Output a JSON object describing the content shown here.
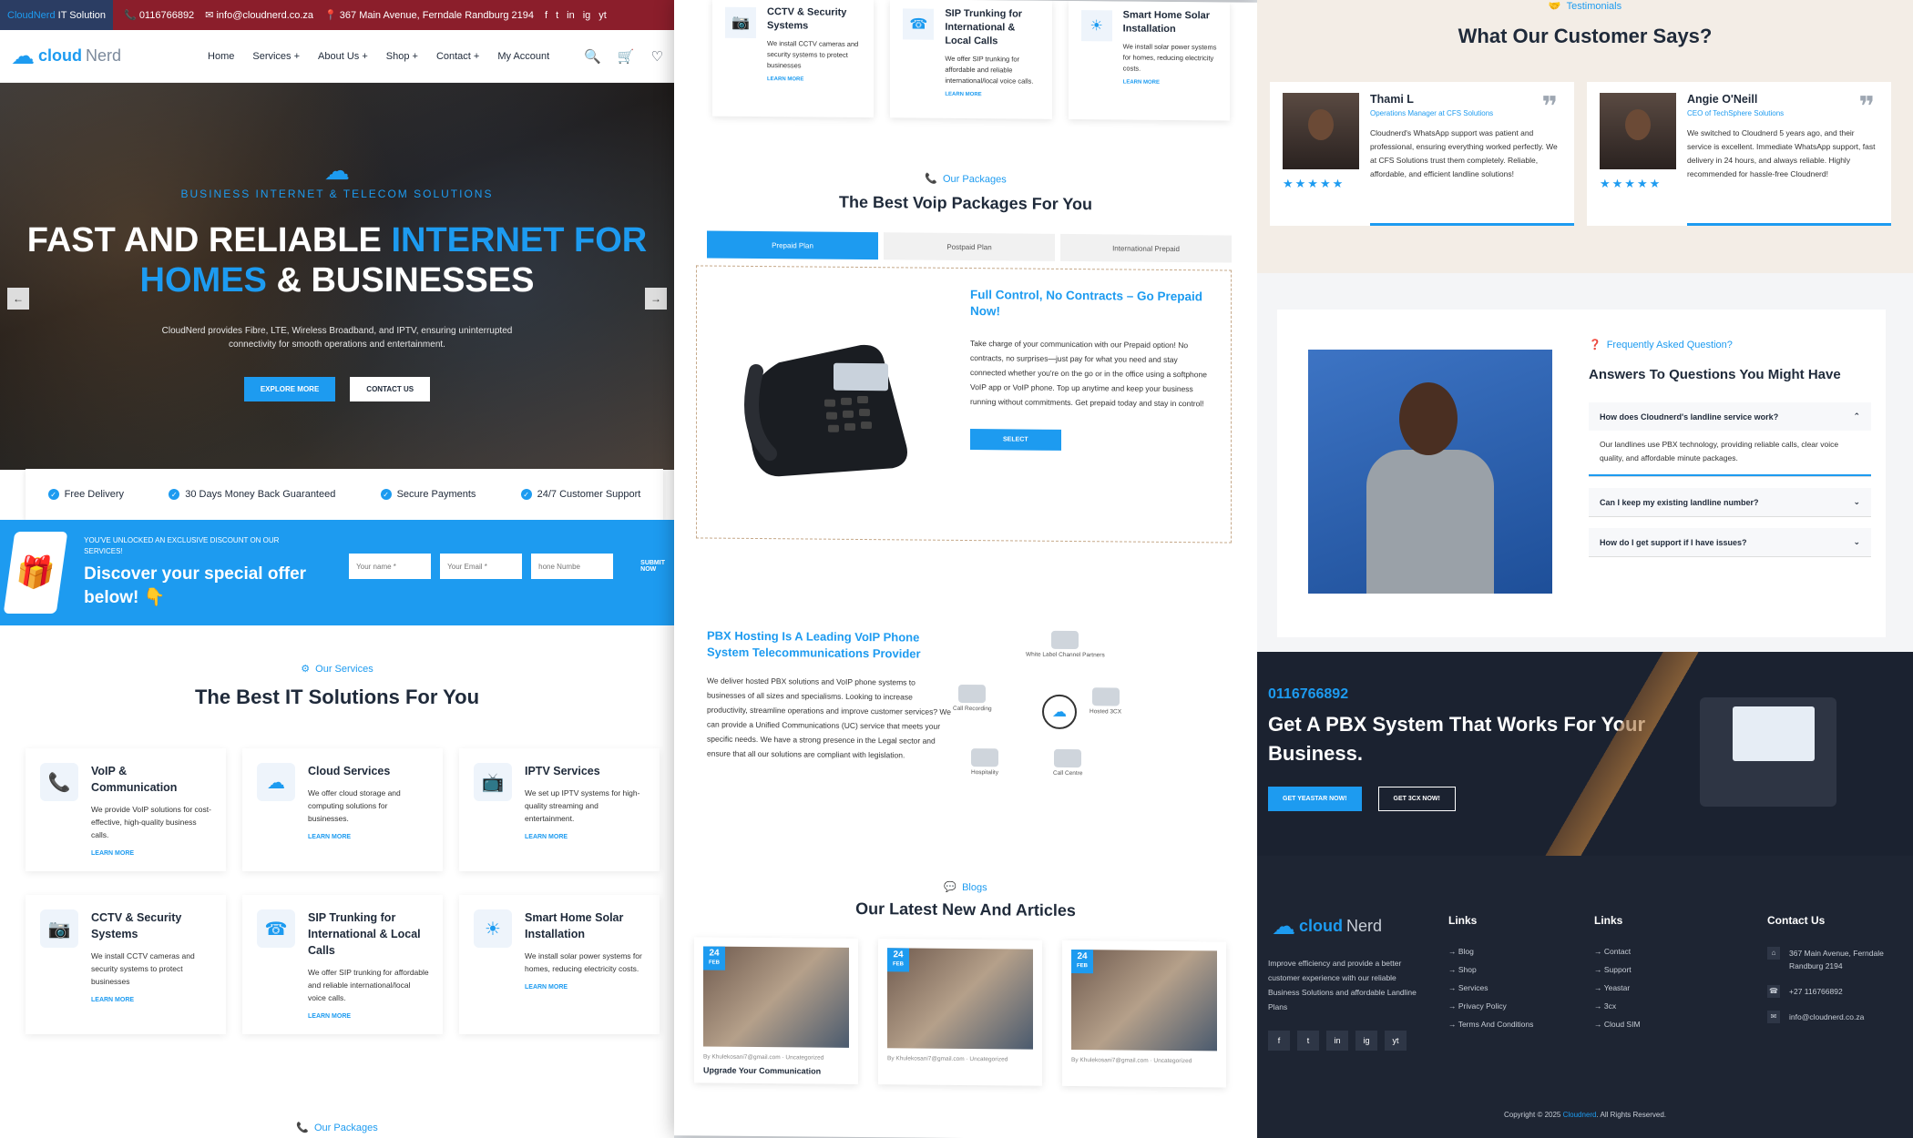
{
  "left": {
    "topbar": {
      "brand_a": "CloudNerd",
      "brand_b": "IT Solution",
      "phone": "0116766892",
      "email": "info@cloudnerd.co.za",
      "address": "367 Main Avenue, Ferndale Randburg 2194",
      "social": [
        "f",
        "t",
        "in",
        "ig",
        "yt"
      ]
    },
    "nav": {
      "logo_a": "cloud",
      "logo_b": "Nerd",
      "links": [
        "Home",
        "Services +",
        "About Us +",
        "Shop +",
        "Contact +",
        "My Account"
      ],
      "icons": [
        "search-icon",
        "cart-icon",
        "heart-icon"
      ]
    },
    "hero": {
      "kicker": "BUSINESS INTERNET & TELECOM SOLUTIONS",
      "title_a": "FAST AND RELIABLE ",
      "title_b": "INTERNET FOR",
      "title_c": "HOMES",
      "title_d": " & BUSINESSES",
      "desc": "CloudNerd provides Fibre, LTE, Wireless Broadband, and IPTV, ensuring uninterrupted connectivity for smooth operations and entertainment.",
      "btn_explore": "EXPLORE MORE",
      "btn_contact": "CONTACT US",
      "prev": "←",
      "next": "→"
    },
    "features": [
      "Free Delivery",
      "30 Days Money Back Guaranteed",
      "Secure Payments",
      "24/7 Customer Support"
    ],
    "discount": {
      "small": "YOU'VE UNLOCKED AN EXCLUSIVE DISCOUNT ON OUR SERVICES!",
      "big": "Discover your special offer below! 👇",
      "name_ph": "Your name *",
      "email_ph": "Your Email *",
      "phone_ph": "hone Numbe",
      "submit": "SUBMIT NOW"
    },
    "services": {
      "kicker": "Our Services",
      "title": "The Best IT Solutions For You",
      "items": [
        {
          "icon": "phone-icon",
          "title": "VoIP & Communication",
          "desc": "We provide VoIP solutions for cost-effective, high-quality business calls.",
          "link": "LEARN MORE"
        },
        {
          "icon": "cloud-icon",
          "title": "Cloud Services",
          "desc": "We offer cloud storage and computing solutions for businesses.",
          "link": "LEARN MORE"
        },
        {
          "icon": "tv-icon",
          "title": "IPTV Services",
          "desc": "We set up IPTV systems for high-quality streaming and entertainment.",
          "link": "LEARN MORE"
        },
        {
          "icon": "camera-icon",
          "title": "CCTV & Security Systems",
          "desc": "We install CCTV cameras and security systems to protect businesses",
          "link": "LEARN MORE"
        },
        {
          "icon": "sip-icon",
          "title": "SIP Trunking for International & Local Calls",
          "desc": "We offer SIP trunking for affordable and reliable international/local voice calls.",
          "link": "LEARN MORE"
        },
        {
          "icon": "solar-icon",
          "title": "Smart Home Solar Installation",
          "desc": "We install solar power systems for homes, reducing electricity costs.",
          "link": "LEARN MORE"
        }
      ]
    },
    "packages_kicker": "Our Packages"
  },
  "mid": {
    "top_cards": [
      {
        "icon": "camera-icon",
        "title": "CCTV & Security Systems",
        "desc": "We install CCTV cameras and security systems to protect businesses",
        "link": "LEARN MORE"
      },
      {
        "icon": "sip-icon",
        "title": "SIP Trunking for International & Local Calls",
        "desc": "We offer SIP trunking for affordable and reliable international/local voice calls.",
        "link": "LEARN MORE"
      },
      {
        "icon": "solar-icon",
        "title": "Smart Home Solar Installation",
        "desc": "We install solar power systems for homes, reducing electricity costs.",
        "link": "LEARN MORE"
      }
    ],
    "packages": {
      "kicker": "Our Packages",
      "title": "The Best Voip Packages For You",
      "tabs": [
        "Prepaid Plan",
        "Postpaid Plan",
        "International Prepaid"
      ],
      "heading": "Full Control, No Contracts – Go Prepaid Now!",
      "desc": "Take charge of your communication with our Prepaid option! No contracts, no surprises—just pay for what you need and stay connected whether you're on the go or in the office using a softphone VoIP app or VoIP phone. Top up anytime and keep your business running without commitments. Get prepaid today and stay in control!",
      "select": "SELECT"
    },
    "pbx": {
      "title": "PBX Hosting Is A Leading VoIP Phone System Telecommunications Provider",
      "desc": "We deliver hosted PBX solutions and VoIP phone systems to businesses of all sizes and specialisms. Looking to increase productivity, streamline operations and improve customer services? We can provide a Unified Communications (UC) service that meets your specific needs. We have a strong presence in the Legal sector and ensure that all our solutions are compliant with legislation.",
      "nodes": [
        "White Label Channel Partners",
        "Call Recording",
        "Hosted 3CX",
        "Hospitality",
        "Call Centre"
      ]
    },
    "blogs": {
      "kicker": "Blogs",
      "title": "Our Latest New And Articles",
      "items": [
        {
          "day": "24",
          "month": "FEB",
          "meta": "By Khulekosani7@gmail.com  ·  Uncategorized",
          "title": "Upgrade Your Communication"
        },
        {
          "day": "24",
          "month": "FEB",
          "meta": "By Khulekosani7@gmail.com  ·  Uncategorized",
          "title": ""
        },
        {
          "day": "24",
          "month": "FEB",
          "meta": "By Khulekosani7@gmail.com  ·  Uncategorized",
          "title": ""
        }
      ]
    }
  },
  "right": {
    "testimonials": {
      "kicker": "Testimonials",
      "title": "What Our Customer Says?",
      "items": [
        {
          "name": "Thami L",
          "role": "Operations Manager at CFS Solutions",
          "text": "Cloudnerd's WhatsApp support was patient and professional, ensuring everything worked perfectly. We at CFS Solutions trust them completely. Reliable, affordable, and efficient landline solutions!",
          "stars": "★★★★★"
        },
        {
          "name": "Angie O'Neill",
          "role": "CEO of TechSphere Solutions",
          "text": "We switched to Cloudnerd 5 years ago, and their service is excellent. Immediate WhatsApp support, fast delivery in 24 hours, and always reliable. Highly recommended for hassle-free Cloudnerd!",
          "stars": "★★★★★"
        }
      ]
    },
    "faq": {
      "kicker": "Frequently Asked Question?",
      "title": "Answers To Questions You Might Have",
      "items": [
        {
          "q": "How does Cloudnerd's landline service work?",
          "a": "Our landlines use PBX technology, providing reliable calls, clear voice quality, and affordable minute packages.",
          "open": true
        },
        {
          "q": "Can I keep my existing landline number?",
          "a": "",
          "open": false
        },
        {
          "q": "How do I get support if I have issues?",
          "a": "",
          "open": false
        }
      ]
    },
    "cta": {
      "phone": "0116766892",
      "title": "Get A PBX System That Works For Your Business.",
      "btn1": "GET YEASTAR NOW!",
      "btn2": "GET 3CX NOW!"
    },
    "footer": {
      "logo_a": "cloud",
      "logo_b": "Nerd",
      "desc": "Improve efficiency and provide a better customer experience with our reliable Business Solutions and affordable Landline Plans",
      "social": [
        "f",
        "t",
        "in",
        "ig",
        "yt"
      ],
      "links1_title": "Links",
      "links1": [
        "→ Blog",
        "→ Shop",
        "→ Services",
        "→ Privacy Policy",
        "→ Terms And Conditions"
      ],
      "links2_title": "Links",
      "links2": [
        "→ Contact",
        "→ Support",
        "→ Yeastar",
        "→ 3cx",
        "→ Cloud SIM"
      ],
      "contact_title": "Contact Us",
      "address": "367 Main Avenue, Ferndale Randburg 2194",
      "phone": "+27 116766892",
      "email": "info@cloudnerd.co.za",
      "copyright_a": "Copyright © 2025 ",
      "copyright_b": "Cloudnerd",
      "copyright_c": ". All Rights Reserved."
    }
  }
}
